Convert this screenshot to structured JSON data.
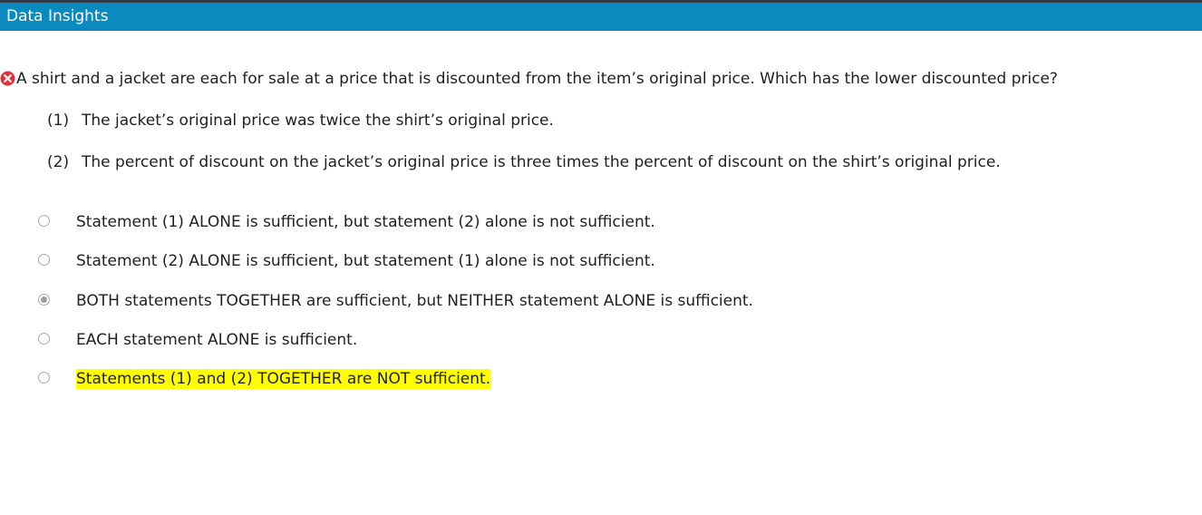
{
  "header": {
    "title": "Data Insights"
  },
  "question": {
    "status_icon": "incorrect-x-icon",
    "status_color": "#e0303a",
    "text": "A shirt and a jacket are each for sale at a price that is discounted from the item’s original price. Which has the lower discounted price?"
  },
  "statements": [
    {
      "number": "(1)",
      "text": "The jacket’s original price was twice the shirt’s original price."
    },
    {
      "number": "(2)",
      "text": "The percent of discount on the jacket’s original price is three times the percent of discount on the shirt’s original price."
    }
  ],
  "choices": [
    {
      "label": "Statement (1) ALONE is sufficient, but statement (2) alone is not sufficient.",
      "selected": false,
      "highlighted": false
    },
    {
      "label": "Statement (2) ALONE is sufficient, but statement (1) alone is not sufficient.",
      "selected": false,
      "highlighted": false
    },
    {
      "label": "BOTH statements TOGETHER are sufficient, but NEITHER statement ALONE is sufficient.",
      "selected": true,
      "highlighted": false
    },
    {
      "label": "EACH statement ALONE is sufficient.",
      "selected": false,
      "highlighted": false
    },
    {
      "label": "Statements (1) and (2) TOGETHER are NOT sufficient.",
      "selected": false,
      "highlighted": true
    }
  ],
  "colors": {
    "header_bg": "#0b8ac0",
    "highlight": "#ffff00"
  }
}
